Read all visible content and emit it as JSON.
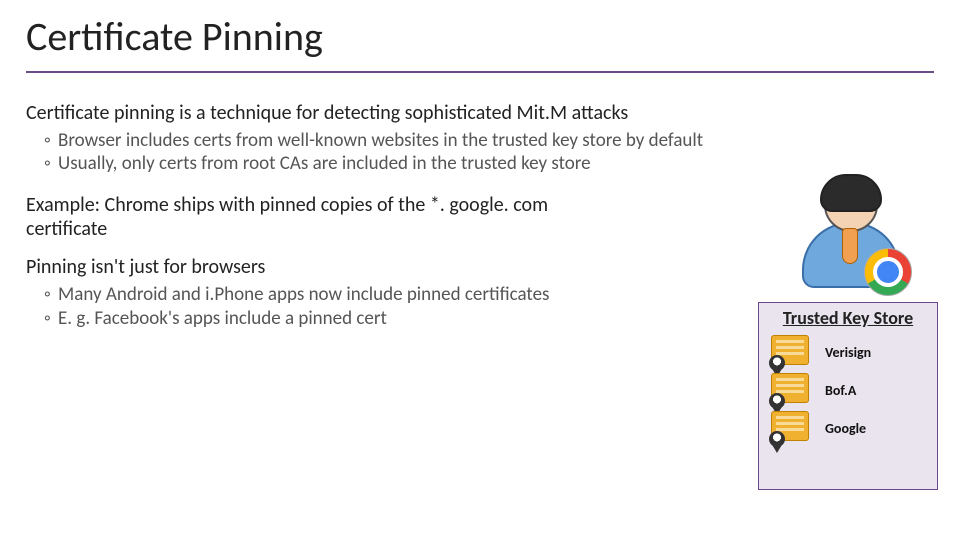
{
  "title": "Certificate Pinning",
  "p1": "Certificate pinning is a technique for detecting sophisticated Mit.M attacks",
  "p1_sub": [
    "Browser includes certs from well-known websites in the trusted key store by default",
    "Usually, only certs from root CAs are included in the trusted key store"
  ],
  "p2": "Example: Chrome ships with pinned copies of the *. google. com certificate",
  "p3": "Pinning isn't just for browsers",
  "p3_sub": [
    "Many Android and i.Phone apps now include pinned certificates",
    "E. g. Facebook's apps include a pinned cert"
  ],
  "illustration": {
    "avatar_name": "user",
    "browser": "Chrome"
  },
  "trusted_key_store": {
    "title": "Trusted Key Store",
    "entries": [
      "Verisign",
      "Bof.A",
      "Google"
    ]
  },
  "colors": {
    "accent": "#6b4c8a",
    "panel_bg": "#eae4ef"
  }
}
